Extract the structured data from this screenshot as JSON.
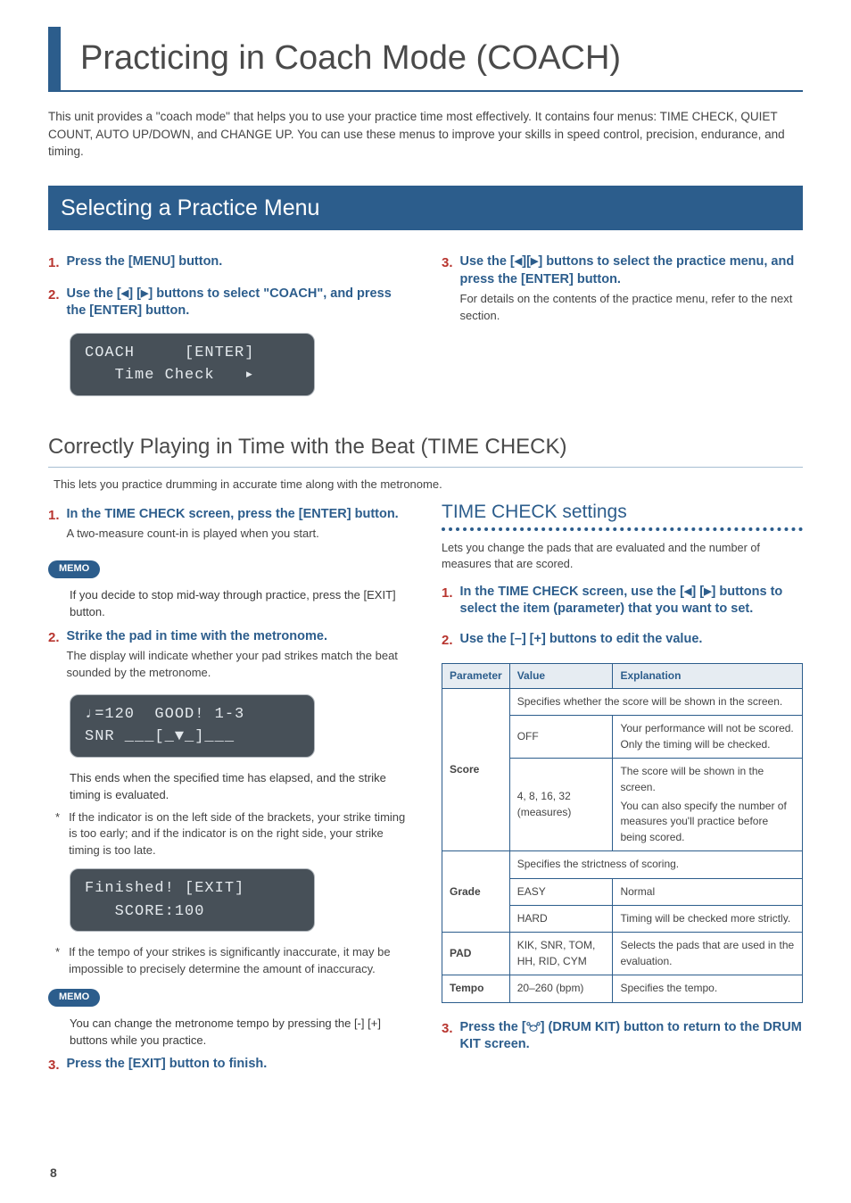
{
  "page_number": "8",
  "title": "Practicing in Coach Mode (COACH)",
  "intro": "This unit provides a \"coach mode\" that helps you to use your practice time most effectively. It contains four menus: TIME CHECK, QUIET COUNT, AUTO UP/DOWN, and CHANGE UP. You can use these menus to improve your skills in speed control, precision, endurance, and timing.",
  "section1": {
    "heading": "Selecting a Practice Menu",
    "step1": "Press the [MENU] button.",
    "step2_a": "Use the [",
    "step2_b": "] [",
    "step2_c": "] buttons to select \"COACH\", and press the [ENTER] button.",
    "lcd1_line1": "COACH     [ENTER]",
    "lcd1_line2": "   Time Check   ▸",
    "step3_a": "Use the [",
    "step3_b": "][",
    "step3_c": "] buttons to select the practice menu, and press the [ENTER] button.",
    "step3_text": "For details on the contents of the practice menu, refer to the next section."
  },
  "section2": {
    "heading": "Correctly Playing in Time with the Beat (TIME CHECK)",
    "desc": "This lets you practice drumming in accurate time along with the metronome.",
    "step1": "In the TIME CHECK screen, press the [ENTER] button.",
    "step1_text": "A two-measure count-in is played when you start.",
    "memo1": "If you decide to stop mid-way through practice, press the [EXIT] button.",
    "step2": "Strike the pad in time with the metronome.",
    "step2_text": "The display will indicate whether your pad strikes match the beat sounded by the metronome.",
    "lcd2_line1": "♩=120  GOOD! 1-3",
    "lcd2_line2": "SNR ___[_▼_]___",
    "note1": "This ends when the specified time has elapsed, and the strike timing is evaluated.",
    "ast1": "If the indicator is on the left side of the brackets, your strike timing is too early; and if the indicator is on the right side, your strike timing is too late.",
    "lcd3_line1": "Finished! [EXIT]",
    "lcd3_line2": "   SCORE:100",
    "ast2": "If the tempo of your strikes is significantly inaccurate, it may be impossible to precisely determine the amount of inaccuracy.",
    "memo2": "You can change the metronome tempo by pressing the [-] [+] buttons while you practice.",
    "step3": "Press the [EXIT] button to finish."
  },
  "settings": {
    "heading": "TIME CHECK settings",
    "desc": "Lets you change the pads that are evaluated and the number of measures that are scored.",
    "step1_a": "In the TIME CHECK screen, use the [",
    "step1_b": "] [",
    "step1_c": "] buttons to select the item (parameter) that you want to set.",
    "step2": "Use the [–] [+] buttons to edit the value.",
    "th_param": "Parameter",
    "th_value": "Value",
    "th_expl": "Explanation",
    "score_label": "Score",
    "score_desc": "Specifies whether the score will be shown in the screen.",
    "score_off_v": "OFF",
    "score_off_e": "Your performance will not be scored. Only the timing will be checked.",
    "score_meas_v": "4, 8, 16, 32 (measures)",
    "score_meas_e1": "The score will be shown in the screen.",
    "score_meas_e2": "You can also specify the number of measures you'll practice before being scored.",
    "grade_label": "Grade",
    "grade_desc": "Specifies the strictness of scoring.",
    "grade_easy_v": "EASY",
    "grade_easy_e": "Normal",
    "grade_hard_v": "HARD",
    "grade_hard_e": "Timing will be checked more strictly.",
    "pad_label": "PAD",
    "pad_v": "KIK, SNR, TOM, HH, RID, CYM",
    "pad_e": "Selects the pads that are used in the evaluation.",
    "tempo_label": "Tempo",
    "tempo_v": "20–260 (bpm)",
    "tempo_e": "Specifies the tempo.",
    "step3_a": "Press the [",
    "step3_b": "] (DRUM KIT) button to return to the DRUM KIT screen."
  },
  "memo_label": "MEMO",
  "left_tri": "◀",
  "right_tri": "▶"
}
